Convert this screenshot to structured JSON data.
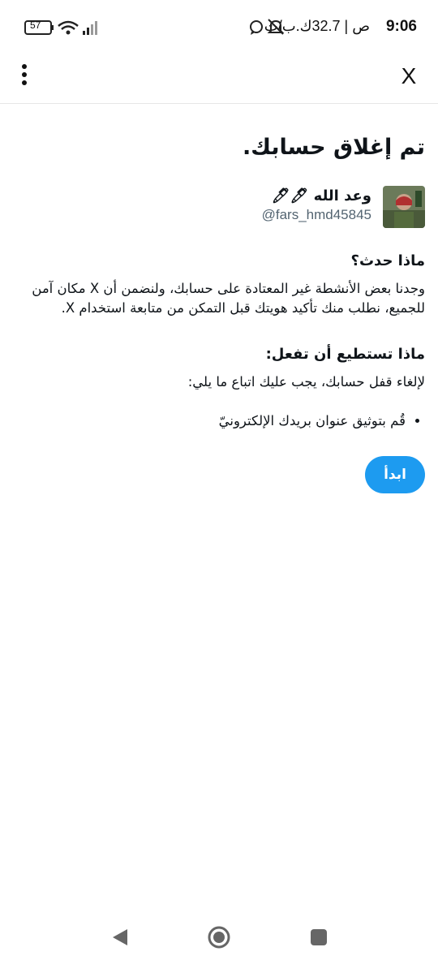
{
  "status_bar": {
    "time": "9:06",
    "info": "ص | 32.7ك.ب/ث",
    "battery": "57"
  },
  "app_bar": {
    "close_label": "X"
  },
  "page": {
    "title": "تم إغلاق حسابك.",
    "account": {
      "name": "وعد الله 🖊🖊",
      "handle": "@fars_hmd45845"
    },
    "what_happened": {
      "heading": "ماذا حدث؟",
      "text": "وجدنا بعض الأنشطة غير المعتادة على حسابك، ولنضمن أن X مكان آمن للجميع، نطلب منك تأكيد هويتك قبل التمكن من متابعة استخدام X."
    },
    "what_can_do": {
      "heading": "ماذا تستطيع أن تفعل:",
      "intro": "لإلغاء قفل حسابك، يجب عليك اتباع ما يلي:",
      "steps": [
        "قُم بتوثيق عنوان بريدك الإلكترونيّ"
      ]
    },
    "start_button": "ابدأ"
  },
  "colors": {
    "accent": "#1d9bf0",
    "text": "#0f1419",
    "muted": "#536471"
  }
}
